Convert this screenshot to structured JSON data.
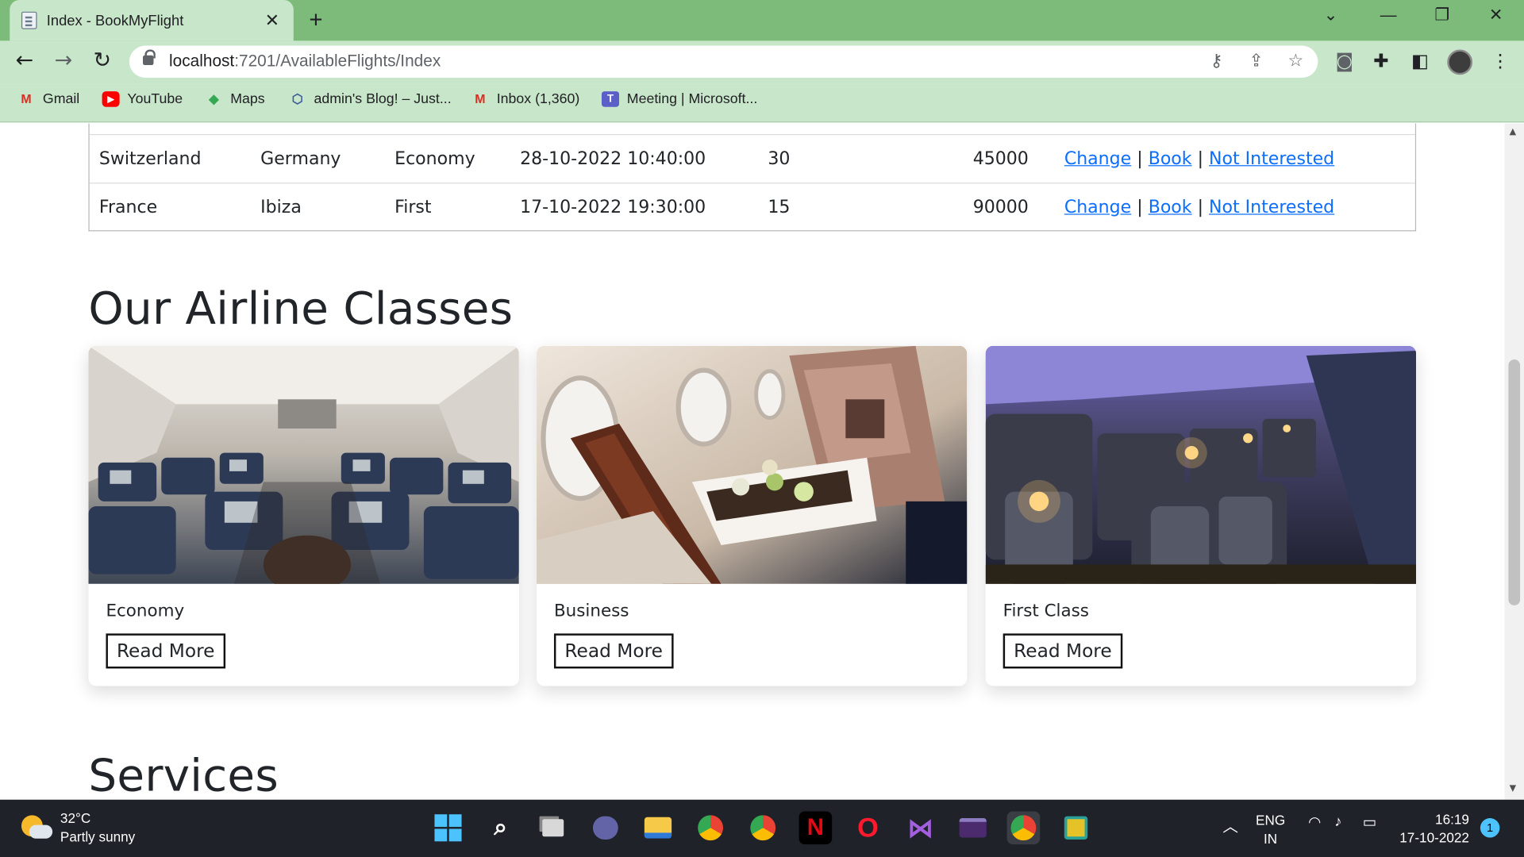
{
  "browser": {
    "tab_title": "Index - BookMyFlight",
    "url_host": "localhost",
    "url_path": ":7201/AvailableFlights/Index",
    "bookmarks": [
      {
        "label": "Gmail",
        "icon": "gmail-icon"
      },
      {
        "label": "YouTube",
        "icon": "youtube-icon"
      },
      {
        "label": "Maps",
        "icon": "maps-icon"
      },
      {
        "label": "admin's Blog! – Just...",
        "icon": "blog-icon"
      },
      {
        "label": "Inbox (1,360)",
        "icon": "gmail-icon"
      },
      {
        "label": "Meeting | Microsoft...",
        "icon": "teams-icon"
      }
    ]
  },
  "flights": {
    "link_change": "Change",
    "link_book": "Book",
    "link_not_interested": "Not Interested",
    "separator": "|",
    "rows": [
      {
        "from": "Switzerland",
        "to": "Germany",
        "class": "Economy",
        "datetime": "28-10-2022 10:40:00",
        "seats": "30",
        "price": "45000"
      },
      {
        "from": "France",
        "to": "Ibiza",
        "class": "First",
        "datetime": "17-10-2022 19:30:00",
        "seats": "15",
        "price": "90000"
      }
    ]
  },
  "classes_section": {
    "heading": "Our Airline Classes",
    "cards": [
      {
        "name": "Economy",
        "button": "Read More"
      },
      {
        "name": "Business",
        "button": "Read More"
      },
      {
        "name": "First Class",
        "button": "Read More"
      }
    ]
  },
  "services_section": {
    "heading": "Services"
  },
  "taskbar": {
    "temperature": "32°C",
    "weather": "Partly sunny",
    "language": "ENG",
    "region": "IN",
    "time": "16:19",
    "date": "17-10-2022",
    "notification_count": "1"
  }
}
